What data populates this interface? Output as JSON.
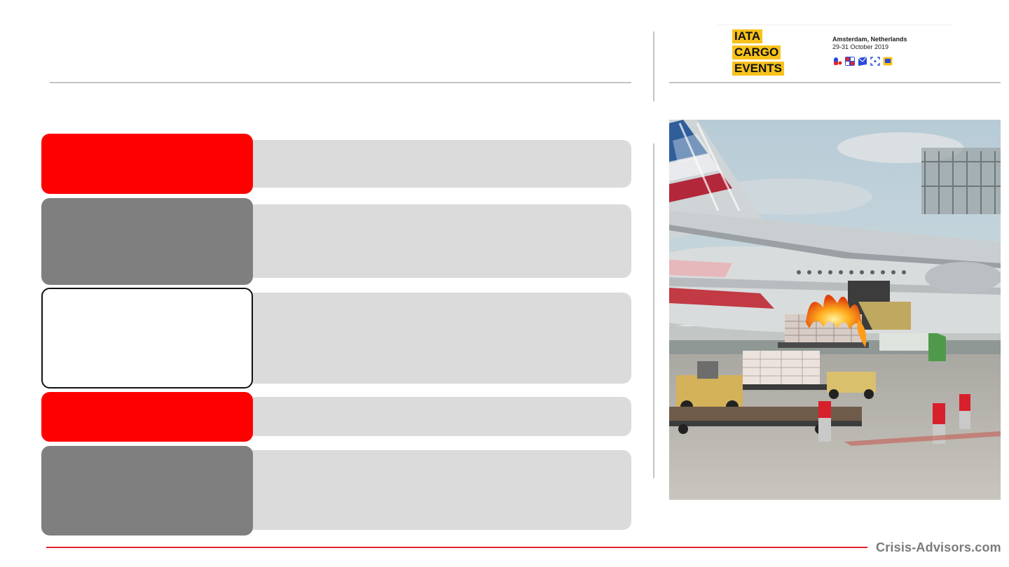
{
  "header": {
    "logo_lines": [
      "IATA",
      "CARGO",
      "EVENTS"
    ],
    "event_location": "Amsterdam, Netherlands",
    "event_dates": "29-31 October 2019",
    "event_icons": [
      "capsule-icon",
      "flag-icon",
      "envelope-icon",
      "expand-icon",
      "screen-icon"
    ]
  },
  "rows": [
    {
      "box_color": "red"
    },
    {
      "box_color": "gray"
    },
    {
      "box_color": "white"
    },
    {
      "box_color": "red"
    },
    {
      "box_color": "gray"
    }
  ],
  "photo": {
    "subject": "aircraft-cargo-fire-photo"
  },
  "footer": {
    "brand": "Crisis-Advisors.com"
  },
  "colors": {
    "accent_red": "#ff0000",
    "box_gray": "#7f7f7f",
    "bar_gray": "#dbdbdb",
    "logo_yellow": "#f7c21a"
  }
}
